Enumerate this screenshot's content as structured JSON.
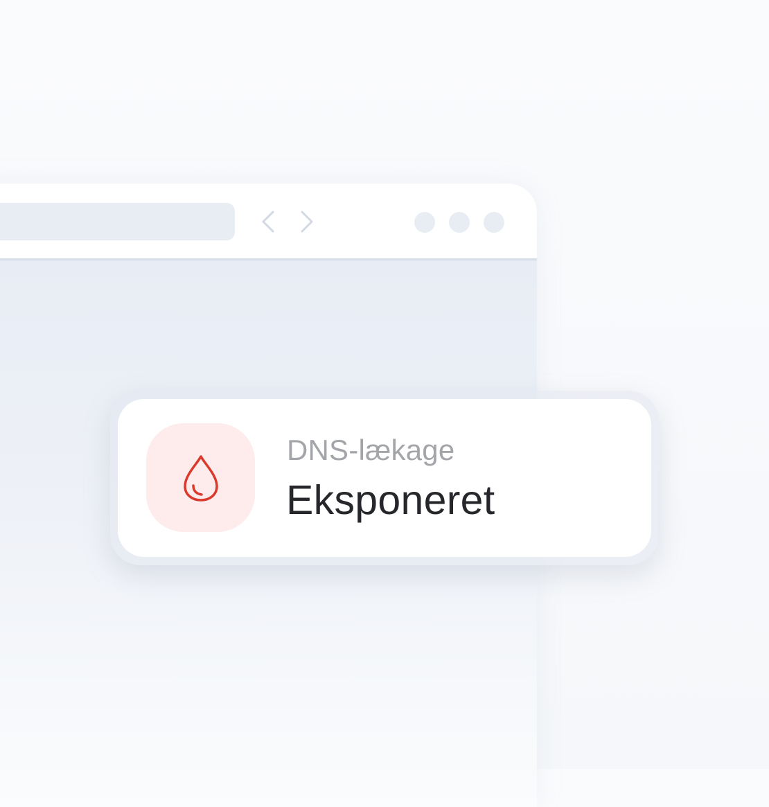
{
  "browser": {
    "icons": {
      "back": "chevron-left-icon",
      "forward": "chevron-right-icon",
      "window_dots": [
        "dot-icon",
        "dot-icon",
        "dot-icon"
      ]
    }
  },
  "status_card": {
    "icon": "droplet-icon",
    "label": "DNS-lækage",
    "value": "Eksponeret"
  },
  "colors": {
    "alert_red": "#d93a2b",
    "alert_tint": "#fdeceb",
    "label_gray": "#a3a5a9",
    "value_dark": "#25272b",
    "chrome_gray": "#e8edf4"
  }
}
